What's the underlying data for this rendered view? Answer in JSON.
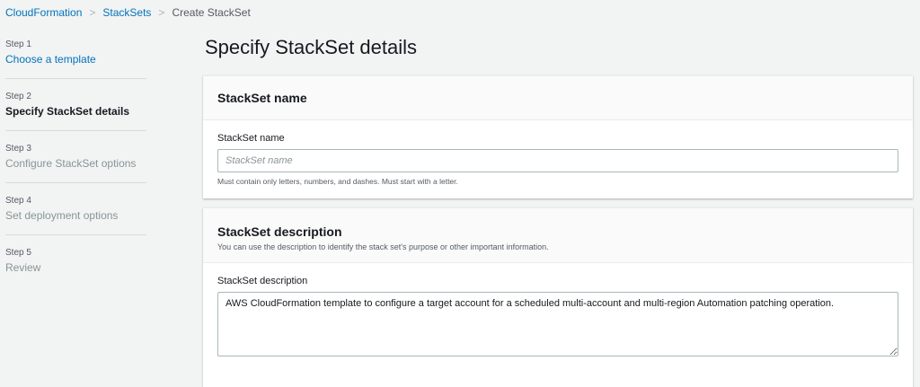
{
  "breadcrumb": [
    "CloudFormation",
    "StackSets",
    "Create StackSet"
  ],
  "steps": [
    {
      "num": "Step 1",
      "label": "Choose a template"
    },
    {
      "num": "Step 2",
      "label": "Specify StackSet details"
    },
    {
      "num": "Step 3",
      "label": "Configure StackSet options"
    },
    {
      "num": "Step 4",
      "label": "Set deployment options"
    },
    {
      "num": "Step 5",
      "label": "Review"
    }
  ],
  "title": "Specify StackSet details",
  "name_panel": {
    "heading": "StackSet name",
    "label": "StackSet name",
    "placeholder": "StackSet name",
    "hint": "Must contain only letters, numbers, and dashes. Must start with a letter."
  },
  "desc_panel": {
    "heading": "StackSet description",
    "description": "You can use the description to identify the stack set's purpose or other important information.",
    "label": "StackSet description",
    "value": "AWS CloudFormation template to configure a target account for a scheduled multi-account and multi-region Automation patching operation."
  }
}
